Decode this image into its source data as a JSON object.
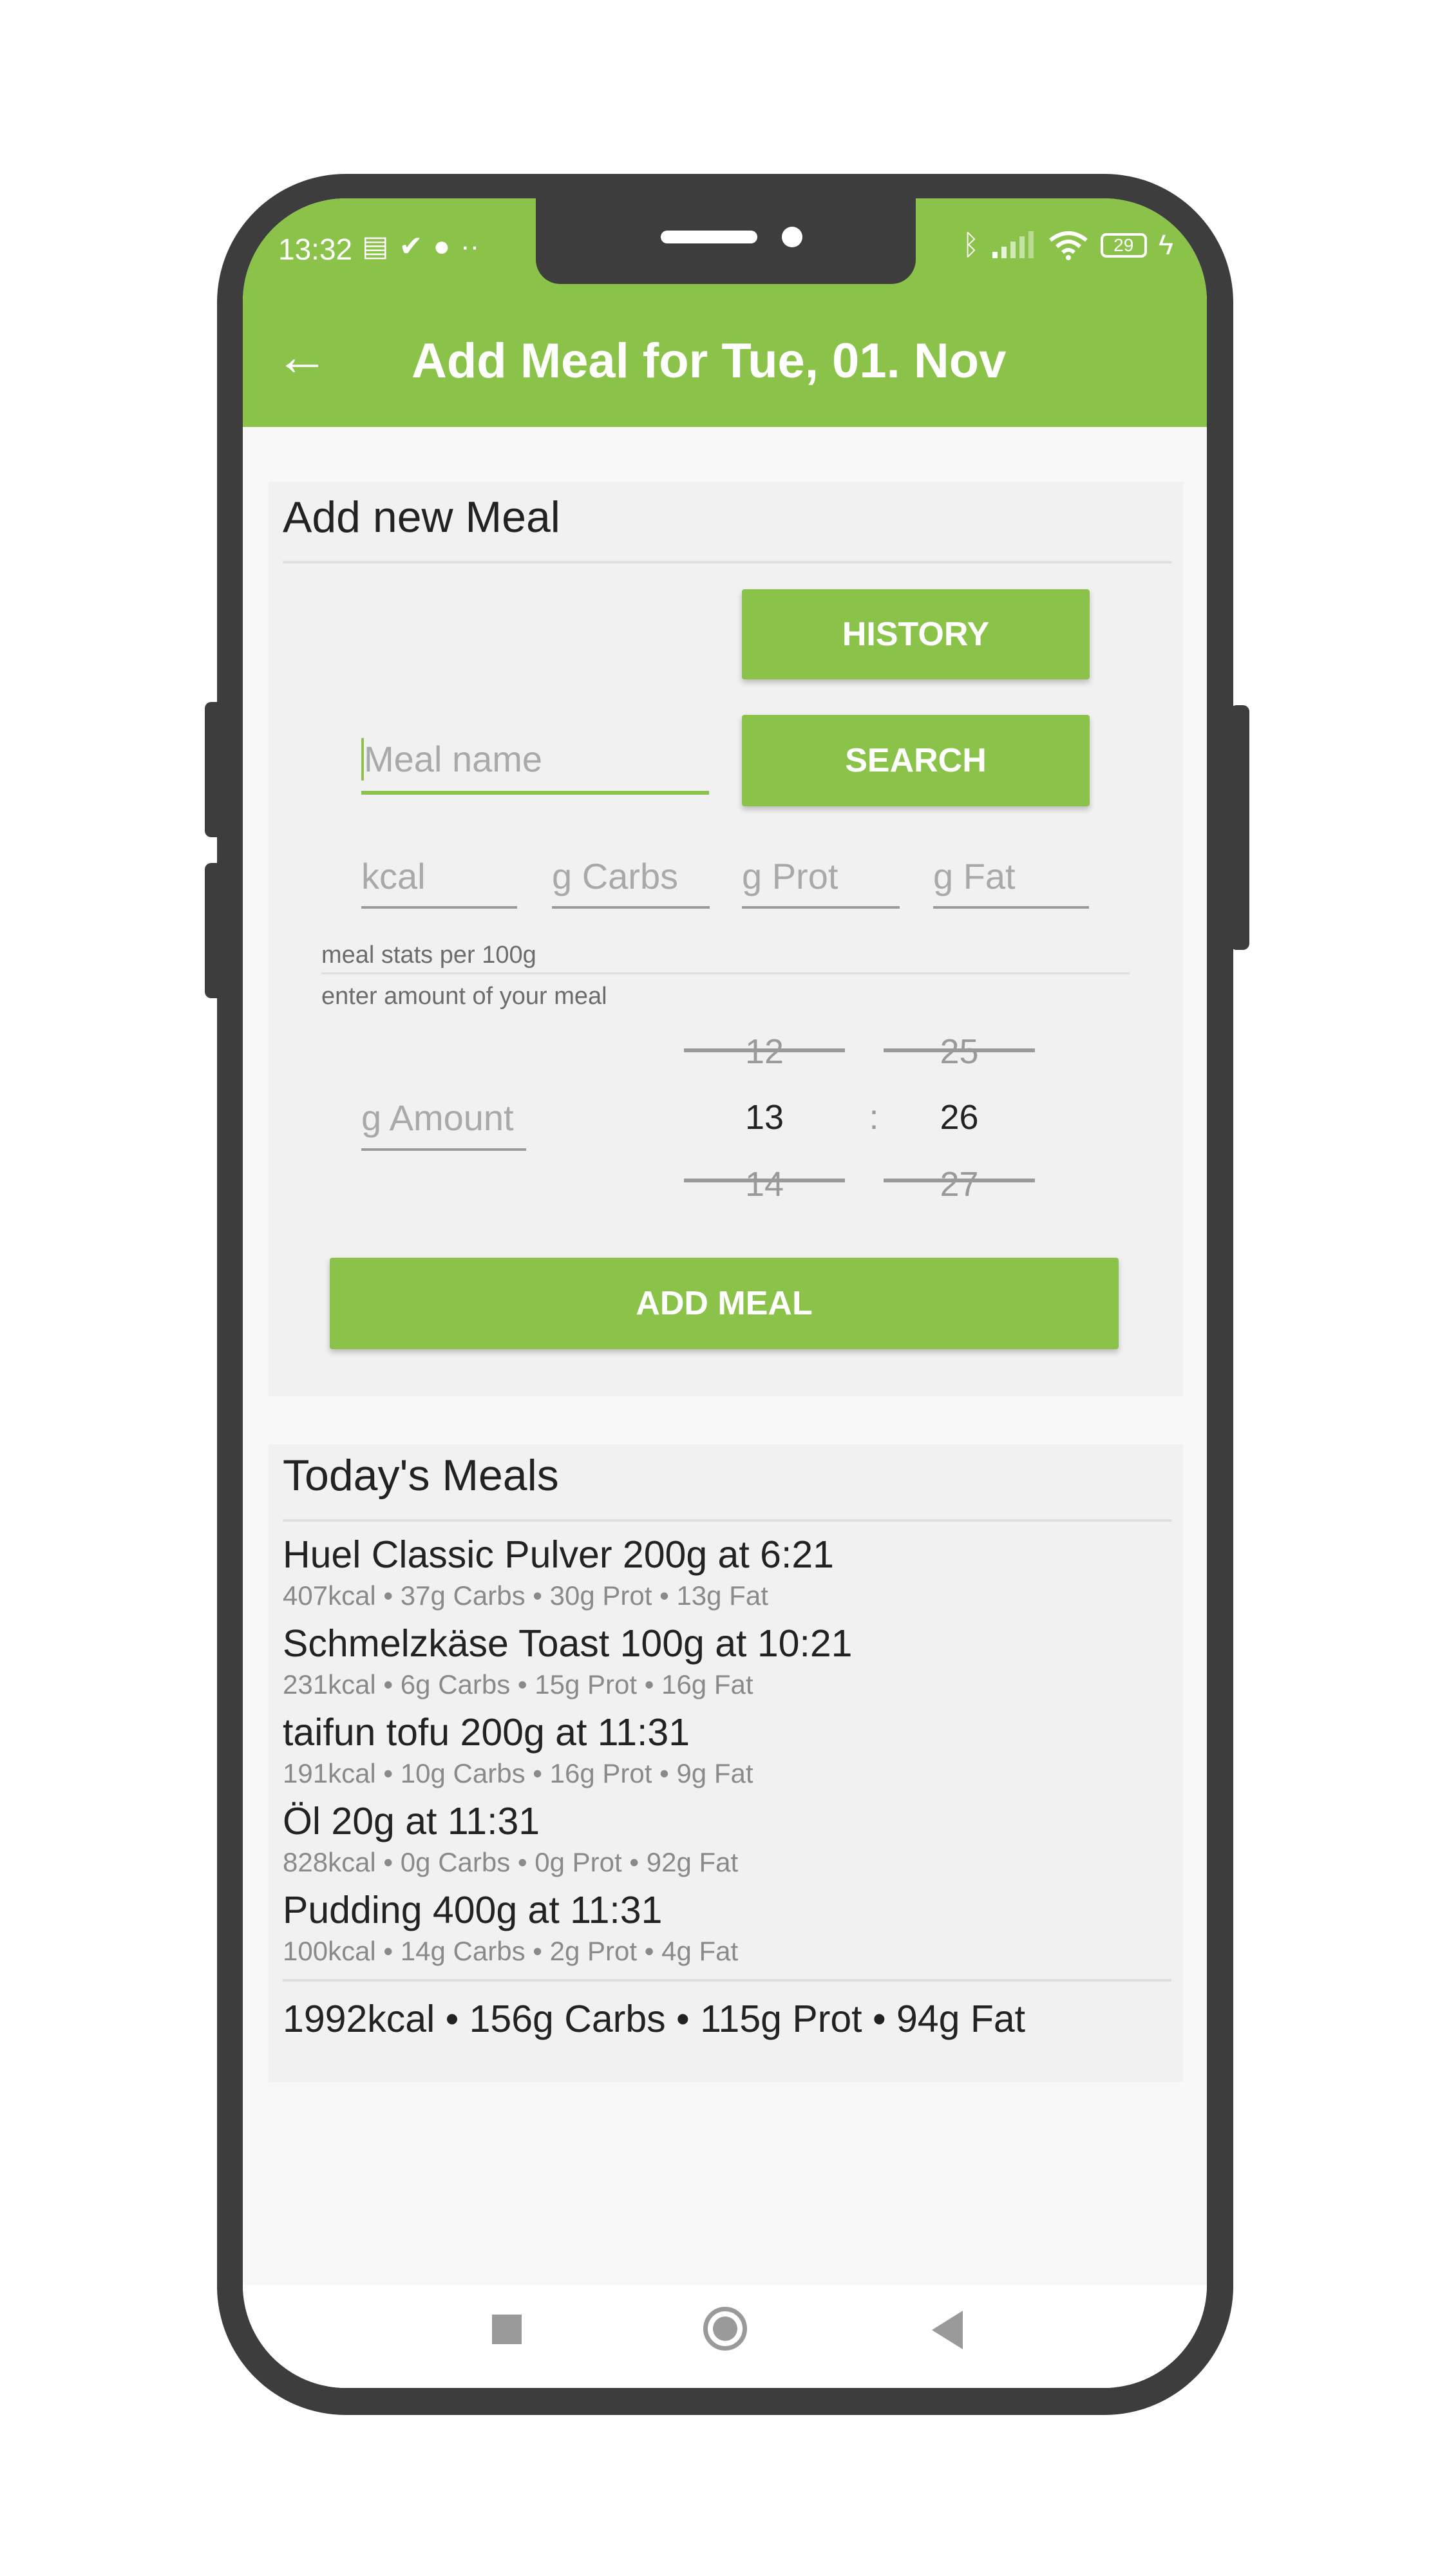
{
  "status_bar": {
    "time": "13:32",
    "battery": "29",
    "left_icons": [
      "notes-icon",
      "check-circle-icon",
      "account-icon",
      "more-icon"
    ],
    "right_icons": [
      "bluetooth-icon",
      "signal-icon",
      "wifi-icon",
      "battery-icon",
      "charging-icon"
    ]
  },
  "app_bar": {
    "title": "Add Meal for Tue, 01. Nov"
  },
  "add_card": {
    "title": "Add new Meal",
    "history_label": "HISTORY",
    "search_label": "SEARCH",
    "meal_name_placeholder": "Meal name",
    "kcal_placeholder": "kcal",
    "carbs_placeholder": "g Carbs",
    "prot_placeholder": "g Prot",
    "fat_placeholder": "g Fat",
    "stats_hint": "meal stats per 100g",
    "amount_hint": "enter amount of your meal",
    "amount_placeholder": "g Amount",
    "time_picker": {
      "hour_prev": "12",
      "hour": "13",
      "hour_next": "14",
      "separator": ":",
      "minute_prev": "25",
      "minute": "26",
      "minute_next": "27"
    },
    "add_label": "ADD MEAL"
  },
  "meals_card": {
    "title": "Today's Meals",
    "meals": [
      {
        "name": "Huel Classic Pulver 200g at 6:21",
        "stats": "407kcal  • 37g Carbs • 30g Prot • 13g Fat"
      },
      {
        "name": "Schmelzkäse Toast 100g at 10:21",
        "stats": "231kcal  • 6g Carbs • 15g Prot • 16g Fat"
      },
      {
        "name": "taifun tofu 200g at 11:31",
        "stats": "191kcal  • 10g Carbs • 16g Prot • 9g Fat"
      },
      {
        "name": "Öl 20g at 11:31",
        "stats": "828kcal  • 0g Carbs • 0g Prot • 92g Fat"
      },
      {
        "name": "Pudding 400g at 11:31",
        "stats": "100kcal  • 14g Carbs • 2g Prot • 4g Fat"
      }
    ],
    "total": "1992kcal  • 156g Carbs • 115g Prot • 94g Fat"
  },
  "colors": {
    "accent": "#8bc34a",
    "frame": "#3d3d3d",
    "card": "#f1f1f1"
  }
}
